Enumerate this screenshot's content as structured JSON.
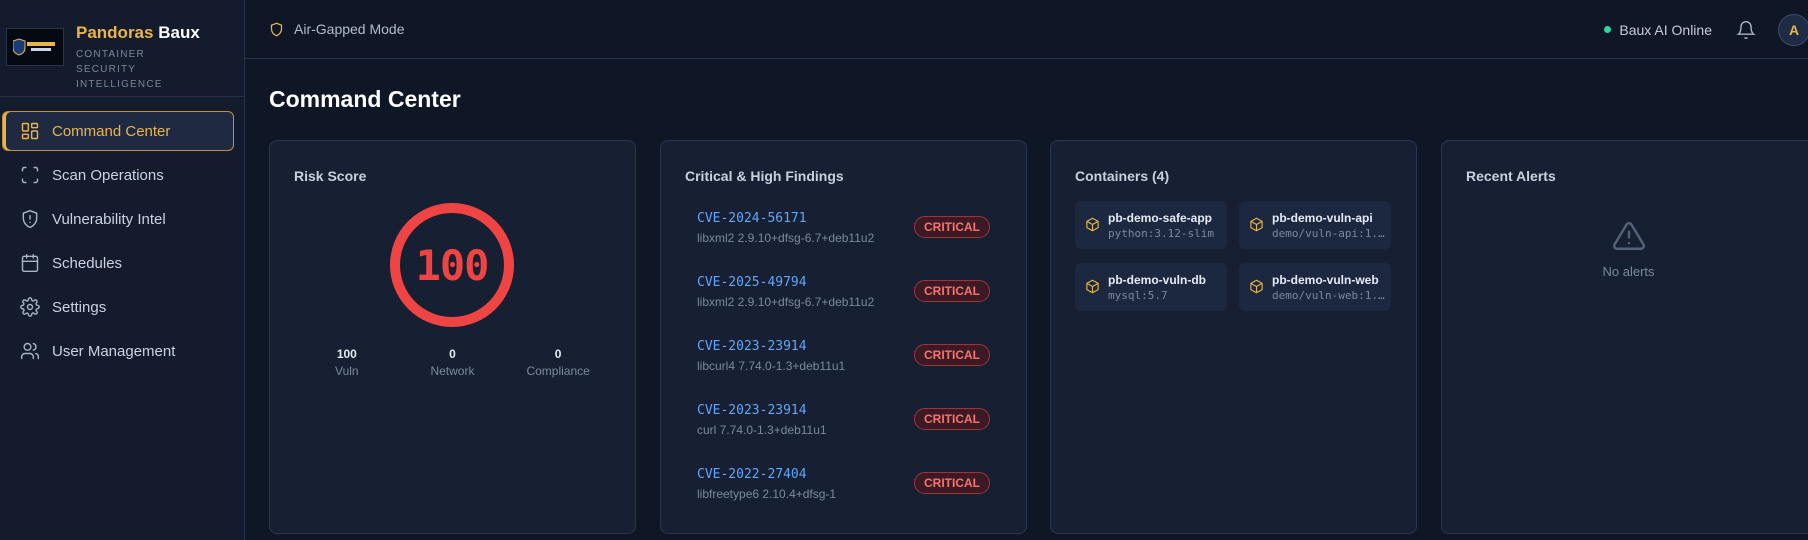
{
  "brand": {
    "name_part1": "Pandoras",
    "name_part2": "Baux",
    "tagline": "CONTAINER SECURITY INTELLIGENCE"
  },
  "sidebar": {
    "items": [
      {
        "label": "Command Center",
        "icon": "dashboard-grid-icon",
        "active": true
      },
      {
        "label": "Scan Operations",
        "icon": "scan-frame-icon"
      },
      {
        "label": "Vulnerability Intel",
        "icon": "shield-icon"
      },
      {
        "label": "Schedules",
        "icon": "calendar-icon"
      },
      {
        "label": "Settings",
        "icon": "gear-icon"
      },
      {
        "label": "User Management",
        "icon": "users-icon"
      }
    ]
  },
  "topbar": {
    "mode_label": "Air-Gapped Mode",
    "ai_status": "Baux AI Online",
    "avatar_initial": "A"
  },
  "page": {
    "title": "Command Center"
  },
  "risk": {
    "title": "Risk Score",
    "score": "100",
    "metrics": [
      {
        "value": "100",
        "label": "Vuln"
      },
      {
        "value": "0",
        "label": "Network"
      },
      {
        "value": "0",
        "label": "Compliance"
      }
    ]
  },
  "findings": {
    "title": "Critical & High Findings",
    "items": [
      {
        "cve": "CVE-2024-56171",
        "package": "libxml2 2.9.10+dfsg-6.7+deb11u2",
        "severity": "CRITICAL"
      },
      {
        "cve": "CVE-2025-49794",
        "package": "libxml2 2.9.10+dfsg-6.7+deb11u2",
        "severity": "CRITICAL"
      },
      {
        "cve": "CVE-2023-23914",
        "package": "libcurl4 7.74.0-1.3+deb11u1",
        "severity": "CRITICAL"
      },
      {
        "cve": "CVE-2023-23914",
        "package": "curl 7.74.0-1.3+deb11u1",
        "severity": "CRITICAL"
      },
      {
        "cve": "CVE-2022-27404",
        "package": "libfreetype6 2.10.4+dfsg-1",
        "severity": "CRITICAL"
      }
    ]
  },
  "containers": {
    "title": "Containers (4)",
    "items": [
      {
        "name": "pb-demo-safe-app",
        "image": "python:3.12-slim"
      },
      {
        "name": "pb-demo-vuln-api",
        "image": "demo/vuln-api:1..."
      },
      {
        "name": "pb-demo-vuln-db",
        "image": "mysql:5.7"
      },
      {
        "name": "pb-demo-vuln-web",
        "image": "demo/vuln-web:1..."
      }
    ]
  },
  "alerts": {
    "title": "Recent Alerts",
    "empty_text": "No alerts"
  },
  "colors": {
    "accent": "#e9b44c",
    "critical": "#ef4444",
    "link": "#60a5fa",
    "online": "#34d399"
  }
}
